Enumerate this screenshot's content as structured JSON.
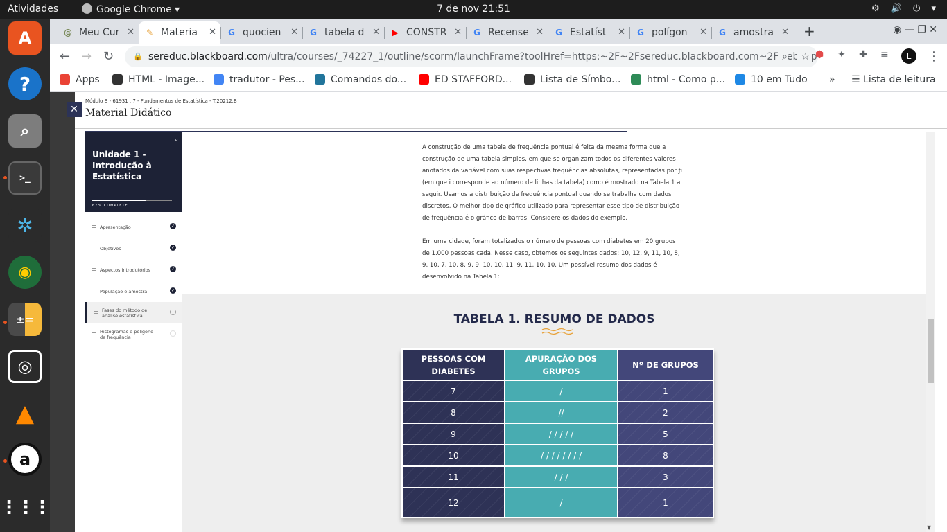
{
  "topbar": {
    "activities": "Atividades",
    "app_name": "Google Chrome ▾",
    "clock": "7 de nov  21:51",
    "system": "⚙ 🔊 ⏻ ▾"
  },
  "dock": {
    "items": [
      "ubuntu-software",
      "help",
      "magnifier",
      "terminal",
      "app-1",
      "app-2",
      "calculator",
      "screenshot",
      "vlc",
      "app-3",
      "show-apps"
    ]
  },
  "tabs": [
    {
      "title": "Meu Curs",
      "icon": "@",
      "color": "#7a8a5a"
    },
    {
      "title": "Materia",
      "icon": "✎",
      "color": "#e8a33c"
    },
    {
      "title": "quocien",
      "icon": "G",
      "color": "#4285f4"
    },
    {
      "title": "tabela d",
      "icon": "G",
      "color": "#4285f4"
    },
    {
      "title": "CONSTR",
      "icon": "▶",
      "color": "#ff0000"
    },
    {
      "title": "Recense",
      "icon": "G",
      "color": "#4285f4"
    },
    {
      "title": "Estatíst",
      "icon": "G",
      "color": "#4285f4"
    },
    {
      "title": "polígon",
      "icon": "G",
      "color": "#4285f4"
    },
    {
      "title": "amostra",
      "icon": "G",
      "color": "#4285f4"
    }
  ],
  "new_tab": "+",
  "window_controls": "◉   —   ❐   ✕",
  "address": {
    "host": "sereduc.blackboard.com",
    "path": "/ultra/courses/_74227_1/outline/scorm/launchFrame?toolHref=https:~2F~2Fsereduc.blackboard.com~2Fwebapp..."
  },
  "bookmarks": [
    {
      "label": "Apps",
      "color": "#ea4335"
    },
    {
      "label": "HTML - Image...",
      "color": "#333333"
    },
    {
      "label": "tradutor - Pes...",
      "color": "#4285f4"
    },
    {
      "label": "Comandos do...",
      "color": "#21759b"
    },
    {
      "label": "ED STAFFORD...",
      "color": "#ff0000"
    },
    {
      "label": "Lista de Símbo...",
      "color": "#333333"
    },
    {
      "label": "html - Como p...",
      "color": "#2e8b57"
    },
    {
      "label": "10 em Tudo",
      "color": "#1e88e5"
    }
  ],
  "bookmarks_more": "»",
  "reading_list": "Lista de leitura",
  "page": {
    "close": "✕",
    "breadcrumb": "Módulo B - 61931 . 7 - Fundamentos de Estatística - T.20212.B",
    "title": "Material Didático"
  },
  "sidebar": {
    "unit_title": "Unidade 1 - Introdução à Estatística",
    "progress_text": "67% COMPLETE",
    "progress": 0.67,
    "items": [
      {
        "label": "Apresentação",
        "state": "done"
      },
      {
        "label": "Objetivos",
        "state": "done"
      },
      {
        "label": "Aspectos introdutórios",
        "state": "done"
      },
      {
        "label": "População e amostra",
        "state": "done"
      },
      {
        "label": "Fases do método de análise estatística",
        "state": "current"
      },
      {
        "label": "Histogramas e polígono de frequência",
        "state": "todo"
      }
    ]
  },
  "article": {
    "p1": "A construção de uma tabela de frequência pontual é feita da mesma forma que a construção de uma tabela simples, em que se organizam todos os diferentes valores anotados da variável com suas respectivas frequências absolutas, representadas por ƒi (em que i corresponde ao número de linhas da tabela) como é mostrado na Tabela 1 a seguir. Usamos a distribuição de frequência pontual quando se trabalha com dados discretos. O melhor tipo de gráfico utilizado para representar esse tipo de distribuição de frequência é o gráfico de barras. Considere os dados do exemplo.",
    "p2": "Em uma cidade, foram totalizados o número de pessoas com diabetes em 20 grupos de 1.000 pessoas cada. Nesse caso, obtemos os seguintes dados: 10, 12, 9, 11, 10, 8, 9, 10, 7, 10, 8, 9, 9, 10, 10, 11, 9, 11, 10, 10. Um possível resumo dos dados é desenvolvido na Tabela 1:",
    "figure_title": "TABELA 1. RESUMO DE DADOS",
    "table": {
      "headers": [
        "PESSOAS COM DIABETES",
        "APURAÇÃO DOS GRUPOS",
        "Nº DE GRUPOS"
      ],
      "rows": [
        [
          "7",
          "/",
          "1"
        ],
        [
          "8",
          "//",
          "2"
        ],
        [
          "9",
          "/ / / / /",
          "5"
        ],
        [
          "10",
          "/ / / / / / / /",
          "8"
        ],
        [
          "11",
          "/ / /",
          "3"
        ],
        [
          "12",
          "/",
          "1"
        ]
      ]
    }
  }
}
